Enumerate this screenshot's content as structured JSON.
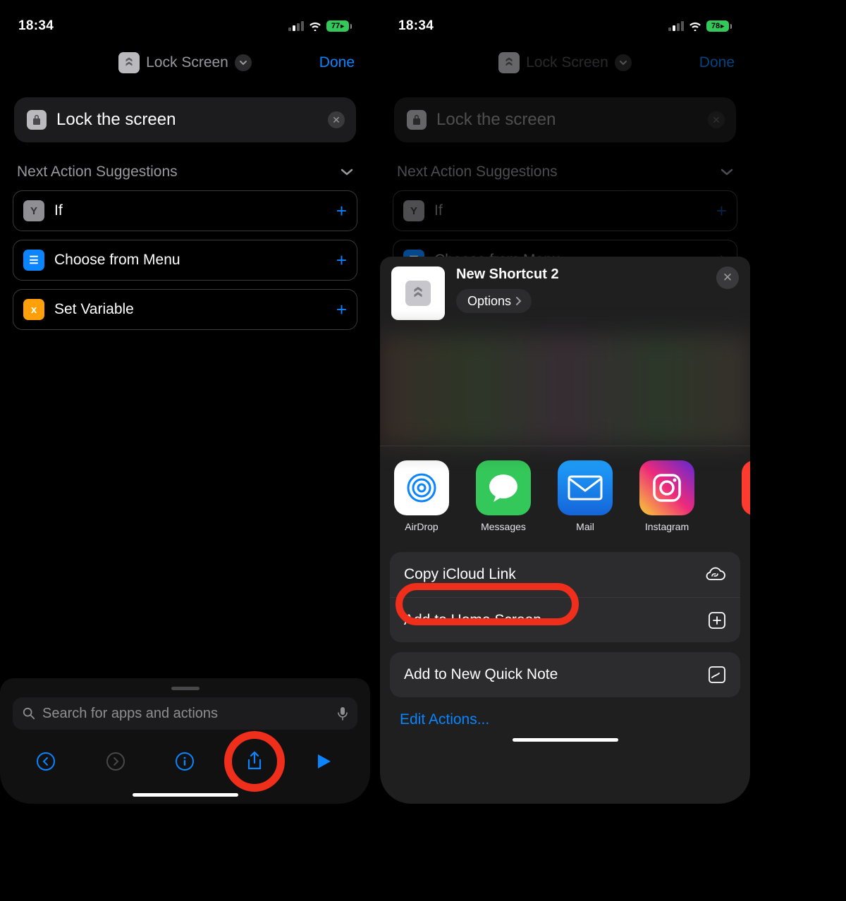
{
  "left": {
    "status": {
      "time": "18:34",
      "battery": "77"
    },
    "header": {
      "title": "Lock Screen",
      "done": "Done"
    },
    "action": {
      "title": "Lock the screen"
    },
    "suggestions": {
      "header": "Next Action Suggestions",
      "items": [
        {
          "label": "If",
          "iconClass": "gray",
          "glyph": "Y"
        },
        {
          "label": "Choose from Menu",
          "iconClass": "blue",
          "glyph": "☰"
        },
        {
          "label": "Set Variable",
          "iconClass": "orange",
          "glyph": "x"
        }
      ]
    },
    "search": {
      "placeholder": "Search for apps and actions"
    }
  },
  "right": {
    "status": {
      "time": "18:34",
      "battery": "78"
    },
    "header": {
      "title": "Lock Screen",
      "done": "Done"
    },
    "action": {
      "title": "Lock the screen"
    },
    "suggestions": {
      "header": "Next Action Suggestions",
      "items": [
        {
          "label": "If",
          "iconClass": "gray",
          "glyph": "Y"
        },
        {
          "label": "Choose from Menu",
          "iconClass": "blue",
          "glyph": "☰"
        }
      ]
    },
    "sheet": {
      "title": "New Shortcut 2",
      "optionsLabel": "Options",
      "apps": [
        {
          "label": "AirDrop",
          "iconClass": "airdrop-icon"
        },
        {
          "label": "Messages",
          "iconClass": "messages-icon"
        },
        {
          "label": "Mail",
          "iconClass": "mail-icon"
        },
        {
          "label": "Instagram",
          "iconClass": "ig-icon"
        }
      ],
      "actions1": [
        {
          "label": "Copy iCloud Link",
          "icon": "cloud-link-icon"
        },
        {
          "label": "Add to Home Screen",
          "icon": "plus-square-icon"
        }
      ],
      "actions2": [
        {
          "label": "Add to New Quick Note",
          "icon": "quick-note-icon"
        }
      ],
      "editLabel": "Edit Actions..."
    }
  }
}
